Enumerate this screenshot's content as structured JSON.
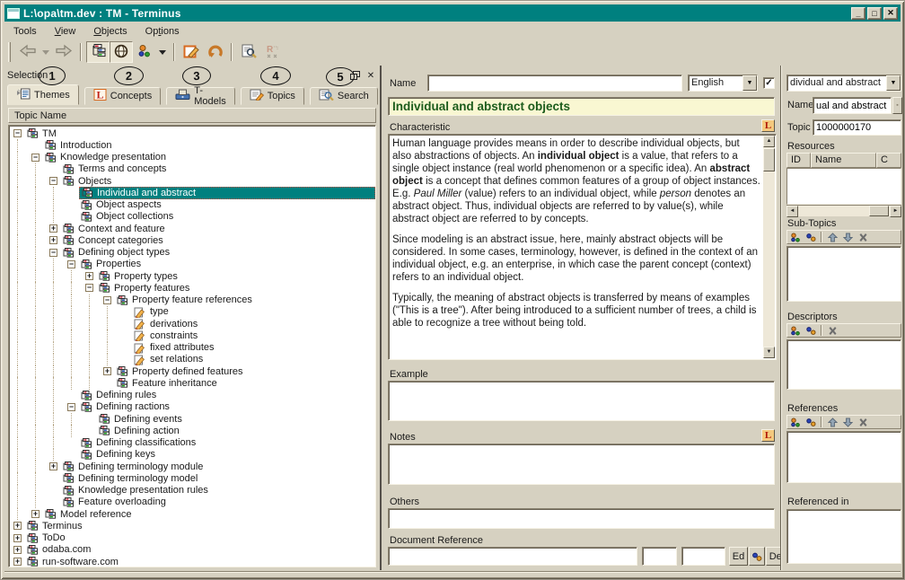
{
  "window": {
    "title": "L:\\opa\\tm.dev : TM - Terminus",
    "controls": [
      "minimize",
      "maximize",
      "close"
    ]
  },
  "menu": {
    "items": [
      {
        "label": "Tools",
        "ul": -1
      },
      {
        "label": "View",
        "ul": 0
      },
      {
        "label": "Objects",
        "ul": 0
      },
      {
        "label": "Options",
        "ul": 2
      }
    ]
  },
  "toolbar": {
    "icons": [
      "back-arrow",
      "back-history-dropdown",
      "forward-arrow",
      "tree-view",
      "globe-view",
      "objects-dots-dropdown",
      "edit-topic",
      "undo",
      "find-document",
      "rename-disabled"
    ]
  },
  "selection": {
    "title": "Selection",
    "tabs": [
      {
        "label": "Themes",
        "icon": "themes"
      },
      {
        "label": "Concepts",
        "icon": "concepts"
      },
      {
        "label": "T-Models",
        "icon": "tmodels"
      },
      {
        "label": "Topics",
        "icon": "topics"
      },
      {
        "label": "Search",
        "icon": "search"
      }
    ],
    "tree_header": "Topic Name",
    "tree": [
      {
        "t": "TM",
        "l": 0,
        "e": "-",
        "i": "t"
      },
      {
        "t": "Introduction",
        "l": 1,
        "e": "",
        "i": "t"
      },
      {
        "t": "Knowledge presentation",
        "l": 1,
        "e": "-",
        "i": "t"
      },
      {
        "t": "Terms and concepts",
        "l": 2,
        "e": "",
        "i": "t"
      },
      {
        "t": "Objects",
        "l": 2,
        "e": "-",
        "i": "t"
      },
      {
        "t": "Individual and abstract",
        "l": 3,
        "e": "",
        "i": "t",
        "sel": true
      },
      {
        "t": "Object aspects",
        "l": 3,
        "e": "",
        "i": "t"
      },
      {
        "t": "Object collections",
        "l": 3,
        "e": "",
        "i": "t"
      },
      {
        "t": "Context and feature",
        "l": 2,
        "e": "+",
        "i": "t"
      },
      {
        "t": "Concept categories",
        "l": 2,
        "e": "+",
        "i": "t"
      },
      {
        "t": "Defining object types",
        "l": 2,
        "e": "-",
        "i": "t"
      },
      {
        "t": "Properties",
        "l": 3,
        "e": "-",
        "i": "t"
      },
      {
        "t": "Property types",
        "l": 4,
        "e": "+",
        "i": "t"
      },
      {
        "t": "Property features",
        "l": 4,
        "e": "-",
        "i": "t"
      },
      {
        "t": "Property feature references",
        "l": 5,
        "e": "-",
        "i": "t"
      },
      {
        "t": "type",
        "l": 6,
        "e": "",
        "i": "p"
      },
      {
        "t": "derivations",
        "l": 6,
        "e": "",
        "i": "p"
      },
      {
        "t": "constraints",
        "l": 6,
        "e": "",
        "i": "p"
      },
      {
        "t": "fixed attributes",
        "l": 6,
        "e": "",
        "i": "p"
      },
      {
        "t": "set relations",
        "l": 6,
        "e": "",
        "i": "p"
      },
      {
        "t": "Property defined features",
        "l": 5,
        "e": "+",
        "i": "t"
      },
      {
        "t": "Feature inheritance",
        "l": 5,
        "e": "",
        "i": "t"
      },
      {
        "t": "Defining rules",
        "l": 3,
        "e": "",
        "i": "t"
      },
      {
        "t": "Defining ractions",
        "l": 3,
        "e": "-",
        "i": "t"
      },
      {
        "t": "Defining events",
        "l": 4,
        "e": "",
        "i": "t"
      },
      {
        "t": "Defining action",
        "l": 4,
        "e": "",
        "i": "t"
      },
      {
        "t": "Defining classifications",
        "l": 3,
        "e": "",
        "i": "t"
      },
      {
        "t": "Defining keys",
        "l": 3,
        "e": "",
        "i": "t"
      },
      {
        "t": "Defining terminology module",
        "l": 2,
        "e": "+",
        "i": "t"
      },
      {
        "t": "Defining terminology model",
        "l": 2,
        "e": "",
        "i": "t"
      },
      {
        "t": "Knowledge presentation rules",
        "l": 2,
        "e": "",
        "i": "t"
      },
      {
        "t": "Feature overloading",
        "l": 2,
        "e": "",
        "i": "t"
      },
      {
        "t": "Model reference",
        "l": 1,
        "e": "+",
        "i": "t"
      },
      {
        "t": "Terminus",
        "l": 0,
        "e": "+",
        "i": "t"
      },
      {
        "t": "ToDo",
        "l": 0,
        "e": "+",
        "i": "t"
      },
      {
        "t": "odaba.com",
        "l": 0,
        "e": "+",
        "i": "t"
      },
      {
        "t": "run-software.com",
        "l": 0,
        "e": "+",
        "i": "t"
      }
    ]
  },
  "annotations": [
    {
      "label": "1"
    },
    {
      "label": "2"
    },
    {
      "label": "3"
    },
    {
      "label": "4"
    },
    {
      "label": "5"
    }
  ],
  "detail": {
    "name_label": "Name",
    "name_value": "",
    "language": "English",
    "language_checked": true,
    "title": "Individual and abstract objects",
    "characteristic_label": "Characteristic",
    "paragraphs": [
      [
        {
          "t": "Human language provides means in order to describe individual objects, but also abstractions of objects. An "
        },
        {
          "t": "individual object",
          "b": true
        },
        {
          "t": " is a value, that refers to a single object instance (real world phenomenon or a specific idea). An "
        },
        {
          "t": "abstract object",
          "b": true
        },
        {
          "t": " is a concept that defines common features of a group of object instances. E.g. "
        },
        {
          "t": "Paul Miller",
          "it": true
        },
        {
          "t": " (value) refers to an individual object, while "
        },
        {
          "t": "person",
          "it": true
        },
        {
          "t": " denotes an abstract object. Thus, individual objects are referred to by value(s), while abstract object are referred to by concepts."
        }
      ],
      [
        {
          "t": "Since modeling is an abstract issue, here, mainly abstract objects will be considered. In some cases, terminology, however, is defined in the context of an individual object, e.g. an enterprise, in which case the parent concept (context) refers to an individual object."
        }
      ],
      [
        {
          "t": "Typically, the meaning of abstract objects is transferred by means of examples (\"This is a tree\"). After being introduced to a sufficient number of trees, a child is able to recognize a tree without being told."
        }
      ]
    ],
    "example_label": "Example",
    "example_value": "",
    "notes_label": "Notes",
    "notes_value": "",
    "others_label": "Others",
    "others_value": "",
    "docref_label": "Document Reference",
    "docref_value": "",
    "edit_button": "Ed",
    "delete_button": "Del"
  },
  "right": {
    "topic_combo_value": "dividual and abstract",
    "name_label": "Name",
    "name_value": "ual and abstract",
    "topic_label": "Topic",
    "topic_value": "1000000170",
    "resources_label": "Resources",
    "resources_columns": [
      "ID",
      "Name",
      "C"
    ],
    "subtopics_label": "Sub-Topics",
    "descriptors_label": "Descriptors",
    "references_label": "References",
    "referenced_in_label": "Referenced in",
    "section_tools": {
      "subtopics": [
        "add-object-icon",
        "link-object-icon",
        "sep",
        "move-up-icon",
        "move-down-icon",
        "delete-icon"
      ],
      "descriptors": [
        "add-object-icon",
        "link-object-icon",
        "sep",
        "delete-icon"
      ],
      "references": [
        "add-object-icon",
        "link-object-icon",
        "sep",
        "move-up-icon",
        "move-down-icon",
        "delete-icon"
      ]
    }
  }
}
